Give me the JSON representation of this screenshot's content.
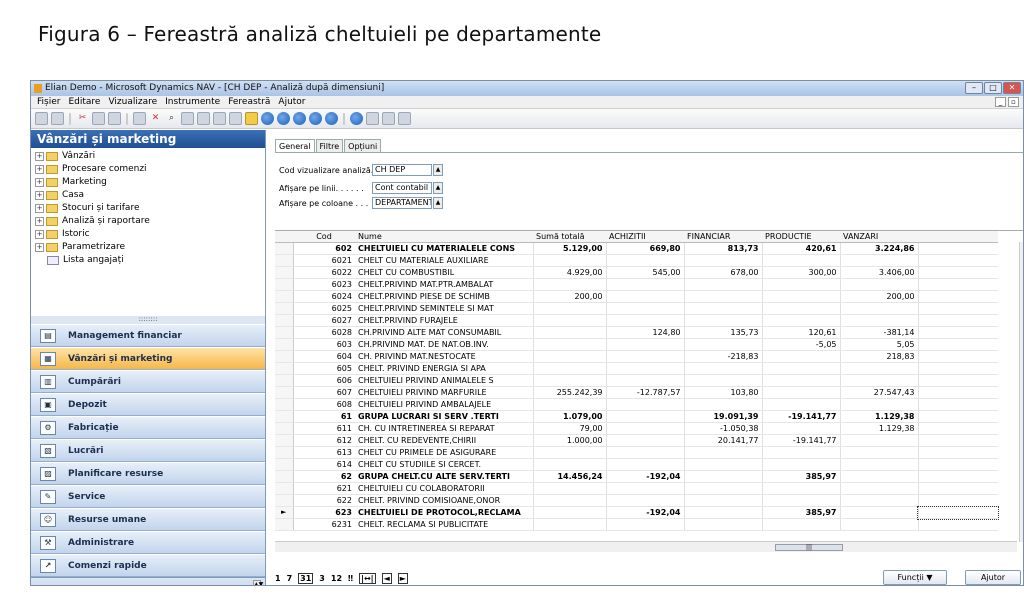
{
  "caption": "Figura 6 – Fereastră  analiză cheltuieli pe departamente",
  "window": {
    "title": "Elian Demo - Microsoft Dynamics NAV - [CH DEP - Analiză după dimensiuni]",
    "min": "–",
    "max": "□",
    "close": "✕"
  },
  "menu": [
    "Fișier",
    "Editare",
    "Vizualizare",
    "Instrumente",
    "Fereastră",
    "Ajutor"
  ],
  "nav": {
    "header": "Vânzări și marketing",
    "tree": [
      "Vânzări",
      "Procesare comenzi",
      "Marketing",
      "Casa",
      "Stocuri și tarifare",
      "Analiză și raportare",
      "Istoric",
      "Parametrizare"
    ],
    "tree_doc": "Lista angajați",
    "grip": "::::::::",
    "buttons": [
      "Management financiar",
      "Vânzări și marketing",
      "Cumpărări",
      "Depozit",
      "Fabricație",
      "Lucrări",
      "Planificare resurse",
      "Service",
      "Resurse umane",
      "Administrare",
      "Comenzi rapide"
    ]
  },
  "tabs": [
    "General",
    "Filtre",
    "Opțiuni"
  ],
  "fields": [
    {
      "label": "Cod vizualizare analiză. .",
      "value": "CH DEP"
    },
    {
      "label": "Afișare pe linii. . . . . .",
      "value": "Cont contabil"
    },
    {
      "label": "Afișare pe coloane . . .",
      "value": "DEPARTAMENTE"
    }
  ],
  "columns": [
    "Cod",
    "Nume",
    "Sumă totală",
    "ACHIZITII",
    "FINANCIAR",
    "PRODUCTIE",
    "VANZARI"
  ],
  "rows": [
    {
      "b": 1,
      "c": [
        "602",
        "CHELTUIELI CU MATERIALELE CONS",
        "5.129,00",
        "669,80",
        "813,73",
        "420,61",
        "3.224,86"
      ]
    },
    {
      "b": 0,
      "c": [
        "6021",
        "CHELT CU MATERIALE AUXILIARE",
        "",
        "",
        "",
        "",
        ""
      ]
    },
    {
      "b": 0,
      "c": [
        "6022",
        "CHELT CU COMBUSTIBIL",
        "4.929,00",
        "545,00",
        "678,00",
        "300,00",
        "3.406,00"
      ]
    },
    {
      "b": 0,
      "c": [
        "6023",
        "CHELT.PRIVIND MAT.PTR.AMBALAT",
        "",
        "",
        "",
        "",
        ""
      ]
    },
    {
      "b": 0,
      "c": [
        "6024",
        "CHELT.PRIVIND PIESE DE SCHIMB",
        "200,00",
        "",
        "",
        "",
        "200,00"
      ]
    },
    {
      "b": 0,
      "c": [
        "6025",
        "CHELT.PRIVIND SEMINTELE SI MAT",
        "",
        "",
        "",
        "",
        ""
      ]
    },
    {
      "b": 0,
      "c": [
        "6027",
        "CHELT.PRIVIND FURAJELE",
        "",
        "",
        "",
        "",
        ""
      ]
    },
    {
      "b": 0,
      "c": [
        "6028",
        "CH.PRIVIND ALTE MAT CONSUMABIL",
        "",
        "124,80",
        "135,73",
        "120,61",
        "-381,14"
      ]
    },
    {
      "b": 0,
      "c": [
        "603",
        "CH.PRIVIND MAT. DE NAT.OB.INV.",
        "",
        "",
        "",
        "-5,05",
        "5,05"
      ]
    },
    {
      "b": 0,
      "c": [
        "604",
        "CH. PRIVIND MAT.NESTOCATE",
        "",
        "",
        "-218,83",
        "",
        "218,83"
      ]
    },
    {
      "b": 0,
      "c": [
        "605",
        "CHELT. PRIVIND ENERGIA SI APA",
        "",
        "",
        "",
        "",
        ""
      ]
    },
    {
      "b": 0,
      "c": [
        "606",
        "CHELTUIELI PRIVIND ANIMALELE S",
        "",
        "",
        "",
        "",
        ""
      ]
    },
    {
      "b": 0,
      "c": [
        "607",
        "CHELTUIELI PRIVIND MARFURILE",
        "255.242,39",
        "-12.787,57",
        "103,80",
        "",
        "27.547,43"
      ]
    },
    {
      "b": 0,
      "c": [
        "608",
        "CHELTUIELI PRIVIND AMBALAJELE",
        "",
        "",
        "",
        "",
        ""
      ]
    },
    {
      "b": 1,
      "c": [
        "61",
        "GRUPA LUCRARI SI SERV .TERTI",
        "1.079,00",
        "",
        "19.091,39",
        "-19.141,77",
        "1.129,38"
      ]
    },
    {
      "b": 0,
      "c": [
        "611",
        "CH. CU INTRETINEREA SI REPARAT",
        "79,00",
        "",
        "-1.050,38",
        "",
        "1.129,38"
      ]
    },
    {
      "b": 0,
      "c": [
        "612",
        "CHELT. CU REDEVENTE,CHIRII",
        "1.000,00",
        "",
        "20.141,77",
        "-19.141,77",
        ""
      ]
    },
    {
      "b": 0,
      "c": [
        "613",
        "CHELT CU PRIMELE DE ASIGURARE",
        "",
        "",
        "",
        "",
        ""
      ]
    },
    {
      "b": 0,
      "c": [
        "614",
        "CHELT CU STUDIILE SI CERCET.",
        "",
        "",
        "",
        "",
        ""
      ]
    },
    {
      "b": 1,
      "c": [
        "62",
        "GRUPA CHELT.CU ALTE SERV.TERTI",
        "14.456,24",
        "-192,04",
        "",
        "385,97",
        ""
      ]
    },
    {
      "b": 0,
      "c": [
        "621",
        "CHELTUIELI CU COLABORATORII",
        "",
        "",
        "",
        "",
        ""
      ]
    },
    {
      "b": 0,
      "c": [
        "622",
        "CHELT. PRIVIND COMISIOANE,ONOR",
        "",
        "",
        "",
        "",
        ""
      ]
    },
    {
      "b": 1,
      "cur": 1,
      "c": [
        "623",
        "CHELTUIELI DE PROTOCOL,RECLAMA",
        "",
        "-192,04",
        "",
        "385,97",
        ""
      ]
    },
    {
      "b": 0,
      "c": [
        "6231",
        "CHELT. RECLAMA SI PUBLICITATE",
        "",
        "",
        "",
        "",
        ""
      ]
    }
  ],
  "pager": [
    "1",
    "7",
    "31",
    "3",
    "12",
    "‼"
  ],
  "buttons": {
    "functii": "Funcții",
    "ajutor": "Ajutor"
  }
}
